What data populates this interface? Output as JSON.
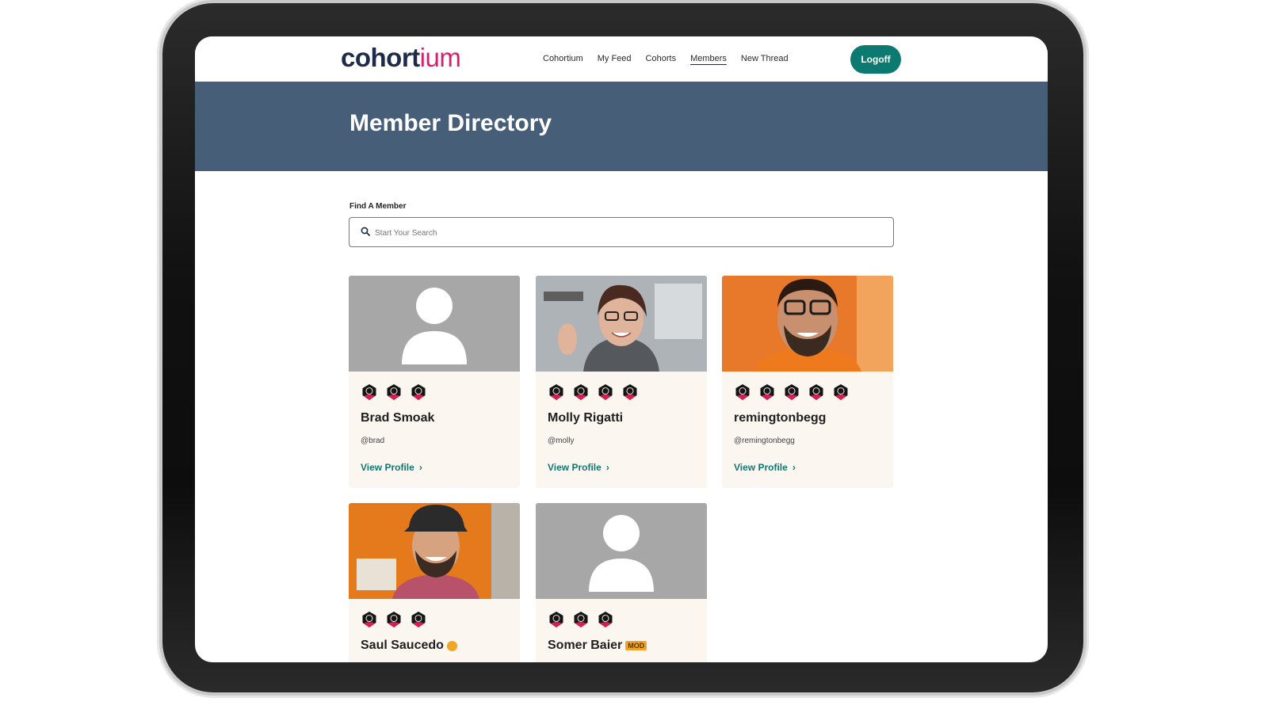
{
  "nav": {
    "logo_main": "cohort",
    "logo_accent": "ium",
    "links": [
      "Cohortium",
      "My Feed",
      "Cohorts",
      "Members",
      "New Thread"
    ],
    "active": "Members",
    "logoff_label": "Logoff"
  },
  "hero": {
    "title": "Member Directory"
  },
  "search": {
    "label": "Find A Member",
    "placeholder": "Start Your Search",
    "value": ""
  },
  "members": [
    {
      "name": "Brad Smoak",
      "handle": "@brad",
      "link": "View Profile",
      "badge_count": 3,
      "photo": "placeholder"
    },
    {
      "name": "Molly Rigatti",
      "handle": "@molly",
      "link": "View Profile",
      "badge_count": 4,
      "photo": "photo"
    },
    {
      "name": "remingtonbegg",
      "handle": "@remingtonbegg",
      "link": "View Profile",
      "badge_count": 5,
      "photo": "photo"
    },
    {
      "name": "Saul Saucedo",
      "badge_count": 3,
      "photo": "photo",
      "verified": true
    },
    {
      "name": "Somer Baier",
      "badge_count": 3,
      "photo": "placeholder",
      "tag": "MOD"
    }
  ],
  "colors": {
    "accent": "#0d7a71",
    "hero": "#465e78",
    "brand_pink": "#d6206f",
    "card_bg": "#fcf6f1",
    "badge_red": "#d81d52"
  }
}
